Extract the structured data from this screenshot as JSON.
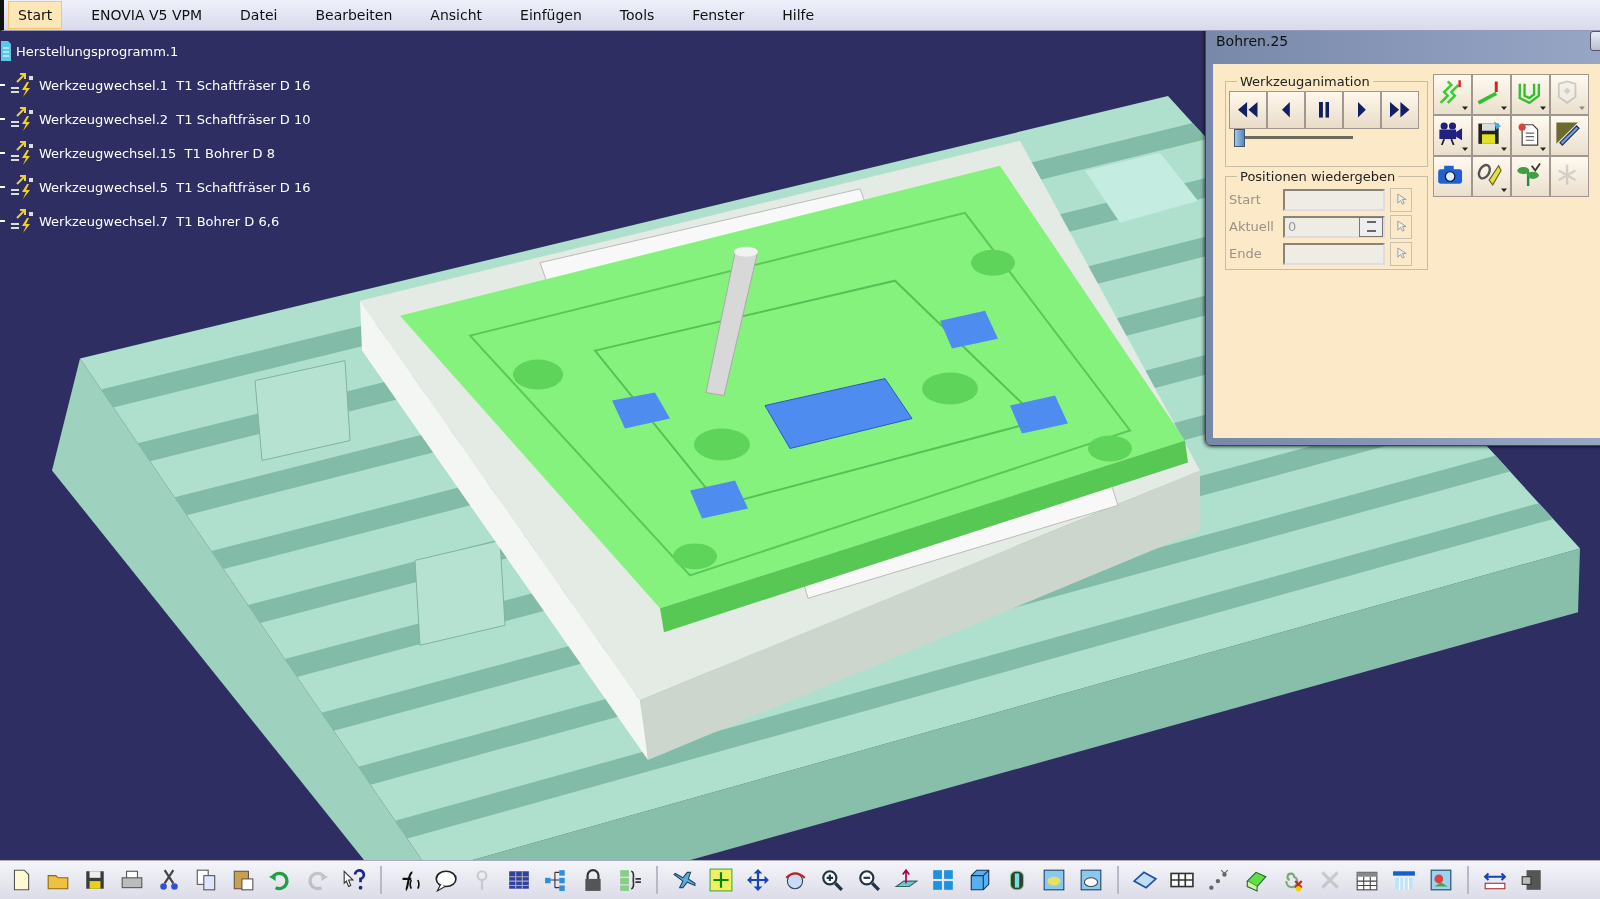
{
  "menu": [
    {
      "label": "Start",
      "selected": true
    },
    {
      "label": "ENOVIA V5 VPM",
      "selected": false
    },
    {
      "label": "Datei",
      "selected": false
    },
    {
      "label": "Bearbeiten",
      "selected": false
    },
    {
      "label": "Ansicht",
      "selected": false
    },
    {
      "label": "Einfügen",
      "selected": false
    },
    {
      "label": "Tools",
      "selected": false
    },
    {
      "label": "Fenster",
      "selected": false
    },
    {
      "label": "Hilfe",
      "selected": false
    }
  ],
  "tree": {
    "label": "Herstellungsprogramm.1",
    "children": [
      {
        "label": "Werkzeugwechsel.1  T1 Schaftfräser D 16"
      },
      {
        "label": "Werkzeugwechsel.2  T1 Schaftfräser D 10"
      },
      {
        "label": "Werkzeugwechsel.15  T1 Bohrer D 8"
      },
      {
        "label": "Werkzeugwechsel.5  T1 Schaftfräser D 16"
      },
      {
        "label": "Werkzeugwechsel.7  T1 Bohrer D 6,6"
      }
    ]
  },
  "dialog": {
    "title": "Bohren.25",
    "animation": {
      "legend": "Werkzeuganimation",
      "slider": {
        "level": 0.02
      }
    },
    "tool_buttons": [
      {
        "disabled": false
      },
      {
        "disabled": false
      },
      {
        "disabled": false
      },
      {
        "disabled": true
      },
      {
        "disabled": false
      },
      {
        "disabled": false
      },
      {
        "disabled": false
      },
      {
        "disabled": false
      },
      {
        "disabled": false
      },
      {
        "disabled": false
      },
      {
        "disabled": false
      },
      {
        "disabled": true
      }
    ],
    "positions": {
      "legend": "Positionen wiedergeben",
      "fields": [
        {
          "label": "Start",
          "disabled": true,
          "kind": "plain"
        },
        {
          "label": "Aktuell",
          "value": "0",
          "disabled": true,
          "kind": "spin"
        },
        {
          "label": "Ende",
          "disabled": true,
          "kind": "plain"
        }
      ]
    }
  },
  "toolbar": {
    "groups": [
      [
        {
          "disabled": false
        },
        {
          "disabled": false
        },
        {
          "disabled": false
        },
        {
          "disabled": false
        },
        {
          "disabled": false
        },
        {
          "disabled": false
        },
        {
          "disabled": false
        },
        {
          "disabled": false
        },
        {
          "disabled": true
        },
        {
          "disabled": false
        }
      ],
      [
        {
          "disabled": false
        },
        {
          "disabled": false
        },
        {
          "disabled": true
        },
        {
          "disabled": false
        },
        {
          "disabled": false
        },
        {
          "disabled": false
        },
        {
          "disabled": false
        }
      ],
      [
        {
          "disabled": false
        },
        {
          "disabled": false
        },
        {
          "disabled": false
        },
        {
          "disabled": false
        },
        {
          "disabled": false
        },
        {
          "disabled": false
        },
        {
          "disabled": false
        },
        {
          "disabled": false
        },
        {
          "disabled": false
        },
        {
          "disabled": false
        },
        {
          "disabled": false
        },
        {
          "disabled": false
        }
      ],
      [
        {
          "disabled": false
        },
        {
          "disabled": false
        },
        {
          "disabled": false
        },
        {
          "disabled": false
        },
        {
          "disabled": false
        },
        {
          "disabled": true
        },
        {
          "disabled": false
        },
        {
          "disabled": false
        },
        {
          "disabled": false
        }
      ],
      [
        {
          "disabled": false
        },
        {
          "disabled": false
        }
      ]
    ]
  }
}
